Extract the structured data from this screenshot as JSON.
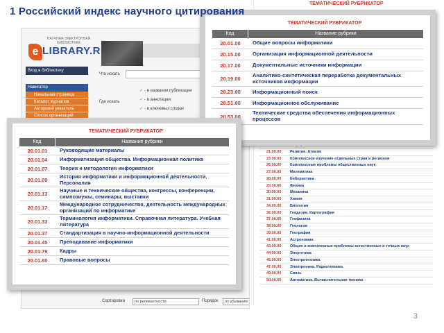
{
  "slide": {
    "title": "1 Российский индекс научного цитирования",
    "number": "3"
  },
  "elibrary": {
    "logo_subtitle": "НАУЧНАЯ ЭЛЕКТРОННАЯ БИБЛИОТЕКА",
    "logo_e": "e",
    "logo_text": "LIBRARY.RU",
    "login_label": "Вход в библиотеку",
    "navigator_label": "Навигатор",
    "nav_items": [
      "Начальная страница",
      "Каталог журналов",
      "Авторский указатель",
      "Список организаций"
    ],
    "search_what_label": "Что искать",
    "search_where_label": "Где искать",
    "search_options": [
      "- в названии публикации",
      "- в аннотации",
      "- в ключевых словах"
    ],
    "sort_label": "Сортировка",
    "sort_value": "по релевантности",
    "order_label": "Порядок",
    "order_value": "по убыванию"
  },
  "right_list": {
    "title": "ТЕМАТИЧЕСКИЙ РУБРИКАТОР",
    "rows": [
      {
        "code": "20.00.00",
        "name": "Информатика"
      },
      {
        "code": "21.00.00",
        "name": "Религия. Атеизм"
      },
      {
        "code": "23.00.00",
        "name": "Комплексное изучение отдельных стран и регионов"
      },
      {
        "code": "26.00.00",
        "name": "Комплексные проблемы общественных наук"
      },
      {
        "code": "27.00.00",
        "name": "Математика"
      },
      {
        "code": "28.00.00",
        "name": "Кибернетика"
      },
      {
        "code": "29.00.00",
        "name": "Физика"
      },
      {
        "code": "30.00.00",
        "name": "Механика"
      },
      {
        "code": "31.00.00",
        "name": "Химия"
      },
      {
        "code": "34.00.00",
        "name": "Биология"
      },
      {
        "code": "36.00.00",
        "name": "Геодезия. Картография"
      },
      {
        "code": "37.00.00",
        "name": "Геофизика"
      },
      {
        "code": "38.00.00",
        "name": "Геология"
      },
      {
        "code": "39.00.00",
        "name": "География"
      },
      {
        "code": "41.00.00",
        "name": "Астрономия"
      },
      {
        "code": "43.00.00",
        "name": "Общие и комплексные проблемы естественных и точных наук"
      },
      {
        "code": "44.00.00",
        "name": "Энергетика"
      },
      {
        "code": "45.00.00",
        "name": "Электротехника"
      },
      {
        "code": "47.00.00",
        "name": "Электроника. Радиотехника"
      },
      {
        "code": "49.00.00",
        "name": "Связь"
      },
      {
        "code": "50.00.00",
        "name": "Автоматика. Вычислительная техника"
      }
    ]
  },
  "popup_top": {
    "title": "ТЕМАТИЧЕСКИЙ РУБРИКАТОР",
    "col_code": "Код",
    "col_name": "Название рубрики",
    "rows": [
      {
        "code": "20.01.00",
        "name": "Общие вопросы информатики"
      },
      {
        "code": "20.15.00",
        "name": "Организация информационной деятельности"
      },
      {
        "code": "20.17.00",
        "name": "Документальные источники информации"
      },
      {
        "code": "20.19.00",
        "name": "Аналитико-синтетическая переработка документальных источников информации"
      },
      {
        "code": "20.23.00",
        "name": "Информационный поиск"
      },
      {
        "code": "20.51.00",
        "name": "Информационное обслуживание"
      },
      {
        "code": "20.53.00",
        "name": "Технические средства обеспечения информационных процессов"
      }
    ]
  },
  "popup_bottom": {
    "title": "ТЕМАТИЧЕСКИЙ РУБРИКАТОР",
    "col_code": "Код",
    "col_name": "Название рубрики",
    "rows": [
      {
        "code": "20.01.01",
        "name": "Руководящие материалы"
      },
      {
        "code": "20.01.04",
        "name": "Информатизация общества. Информационная политика"
      },
      {
        "code": "20.01.07",
        "name": "Теория и методология информатики"
      },
      {
        "code": "20.01.09",
        "name": "История информатики и информационной деятельности. Персоналия"
      },
      {
        "code": "20.01.13",
        "name": "Научные и технические общества, конгрессы, конференции, симпозиумы, семинары, выставки"
      },
      {
        "code": "20.01.17",
        "name": "Международное сотрудничество, деятельность международных организаций по информатике"
      },
      {
        "code": "20.01.33",
        "name": "Терминология информатики. Справочная литература. Учебная литература"
      },
      {
        "code": "20.01.37",
        "name": "Стандартизация в научно-информационной деятельности"
      },
      {
        "code": "20.01.45",
        "name": "Преподавание информатики"
      },
      {
        "code": "20.01.79",
        "name": "Кадры"
      },
      {
        "code": "20.01.80",
        "name": "Правовые вопросы"
      }
    ]
  }
}
